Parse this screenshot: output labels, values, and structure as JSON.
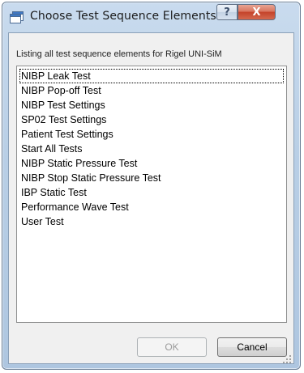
{
  "window": {
    "title": "Choose Test Sequence Elements",
    "help_glyph": "?",
    "close_glyph": "X",
    "icon": "dialog-window-icon"
  },
  "caption": "Listing all test sequence elements for Rigel UNI-SiM",
  "items": [
    "NIBP Leak Test",
    "NIBP Pop-off Test",
    "NIBP Test Settings",
    "SP02 Test Settings",
    "Patient Test Settings",
    "Start All Tests",
    "NIBP Static Pressure Test",
    "NIBP Stop Static Pressure Test",
    "IBP Static Test",
    "Performance Wave Test",
    "User Test"
  ],
  "focused_item": "NIBP Leak Test",
  "buttons": {
    "ok_label": "OK",
    "ok_enabled": false,
    "cancel_label": "Cancel"
  },
  "colors": {
    "close_button": "#c4432a",
    "window_frame": "#b9cfe6",
    "client_background": "#f0f0f0"
  }
}
